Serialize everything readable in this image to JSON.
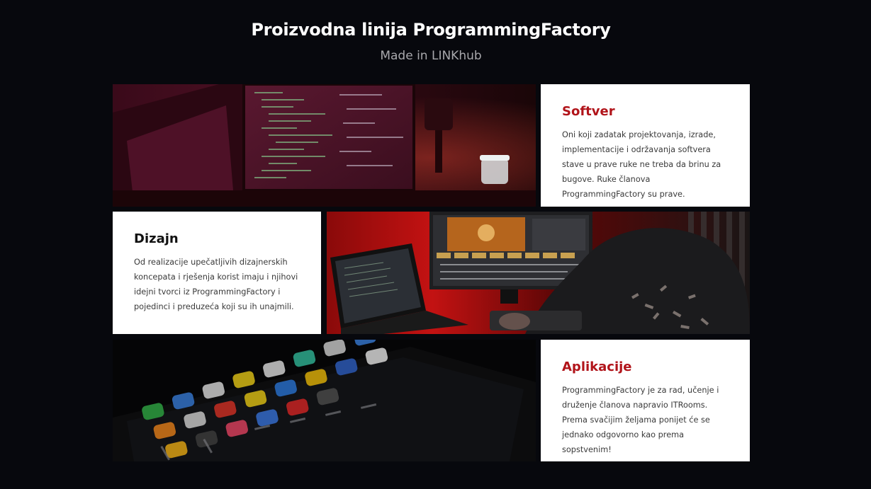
{
  "header": {
    "title": "Proizvodna linija ProgrammingFactory",
    "subtitle": "Made in LINKhub"
  },
  "sections": [
    {
      "title": "Softver",
      "text": "Oni koji zadatak projektovanja, izrade, implementacije i održavanja softvera stave u prave ruke ne treba da brinu za bugove. Ruke članova ProgrammingFactory su prave.",
      "title_color": "#b1141a",
      "image": "code-monitor-photo"
    },
    {
      "title": "Dizajn",
      "text": "Od realizacije upečatljivih dizajnerskih koncepata i rješenja korist imaju i njihovi idejni tvorci iz ProgrammingFactory i pojedinci i preduzeća koji su ih unajmili.",
      "title_color": "#111111",
      "image": "video-editing-photo"
    },
    {
      "title": "Aplikacije",
      "text": "ProgrammingFactory je za rad, učenje i druženje članova napravio ITRooms. Prema svačijim željama ponijet će se jednako odgovorno kao prema sopstvenim!",
      "title_color": "#b1141a",
      "image": "smartphone-apps-photo"
    }
  ]
}
